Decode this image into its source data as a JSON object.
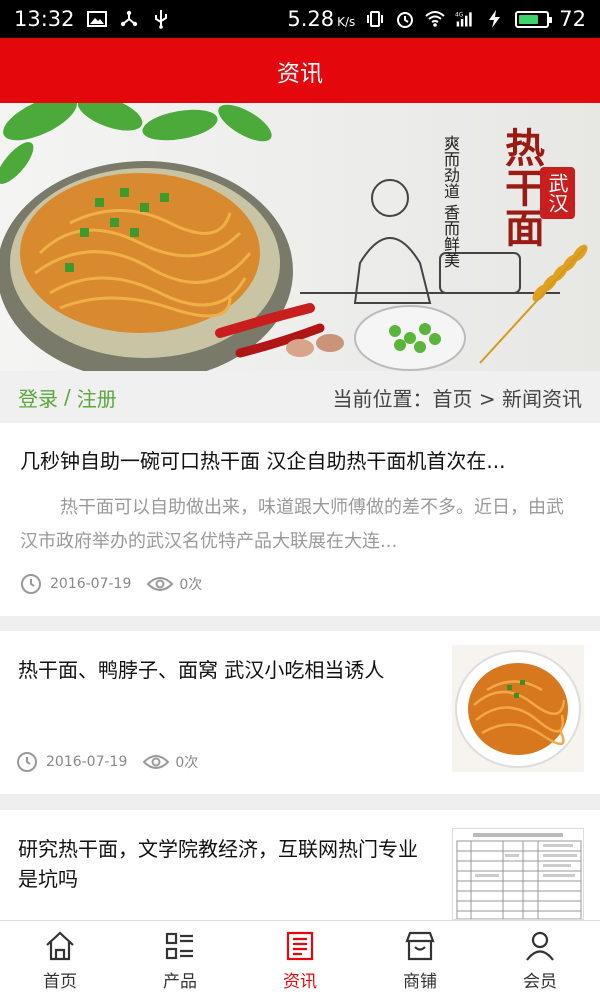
{
  "status_bar": {
    "time": "13:32",
    "speed": "5.28",
    "speed_unit": "K/s",
    "battery": "72",
    "network": "4G"
  },
  "header": {
    "title": "资讯"
  },
  "banner": {
    "slogan": "爽而劲道 香而鲜美",
    "big_title": "热干面",
    "stamp": "武汉"
  },
  "login_bar": {
    "login": "登录",
    "separator": "/",
    "register": "注册",
    "location_label": "当前位置：",
    "location_path": "首页 > 新闻资讯"
  },
  "articles": [
    {
      "title": "几秒钟自助一碗可口热干面 汉企自助热干面机首次在...",
      "summary": "热干面可以自助做出来，味道跟大师傅做的差不多。近日，由武汉市政府举办的武汉名优特产品大联展在大连...",
      "date": "2016-07-19",
      "views": "0次"
    },
    {
      "title": "热干面、鸭脖子、面窝 武汉小吃相当诱人",
      "date": "2016-07-19",
      "views": "0次"
    },
    {
      "title": "研究热干面，文学院教经济，互联网热门专业是坑吗"
    }
  ],
  "tabs": [
    {
      "label": "首页",
      "icon": "home-icon",
      "active": false
    },
    {
      "label": "产品",
      "icon": "list-icon",
      "active": false
    },
    {
      "label": "资讯",
      "icon": "news-icon",
      "active": true
    },
    {
      "label": "商铺",
      "icon": "shop-icon",
      "active": false
    },
    {
      "label": "会员",
      "icon": "user-icon",
      "active": false
    }
  ],
  "colors": {
    "brand_red": "#e4080d",
    "login_green": "#5aa83a",
    "battery_green": "#3ed46a"
  }
}
